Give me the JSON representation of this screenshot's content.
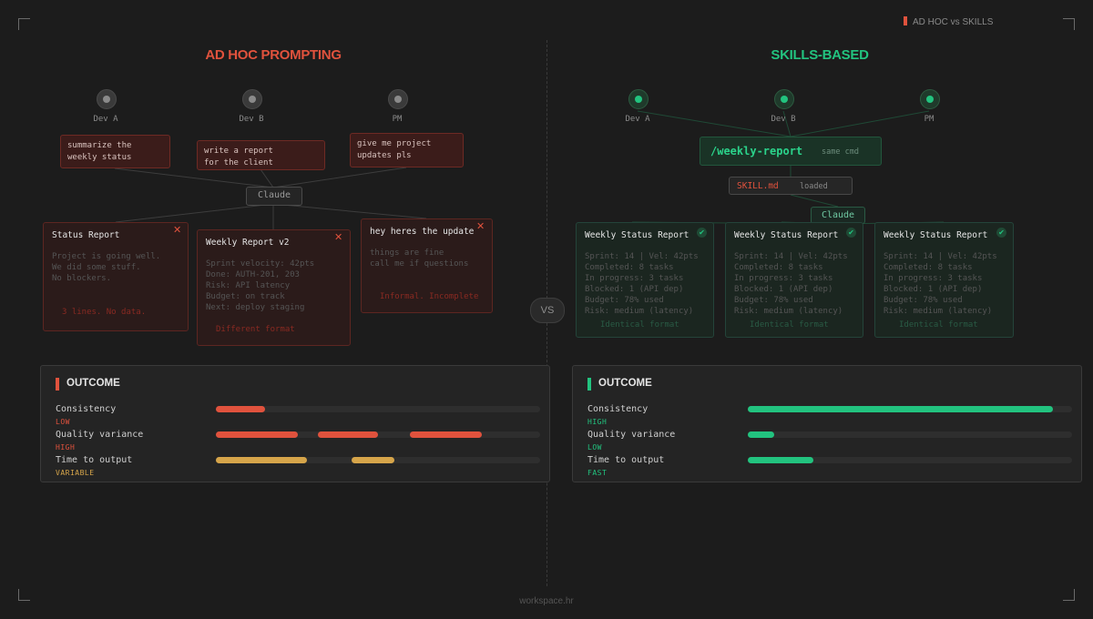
{
  "tag": "AD HOC vs SKILLS",
  "left": {
    "heading": "AD HOC PROMPTING",
    "users": [
      "Dev A",
      "Dev B",
      "PM"
    ],
    "prompts": [
      "summarize the\nweekly status",
      "write a report\nfor the client",
      "give me project\nupdates pls"
    ],
    "model": "Claude",
    "cards": [
      {
        "title": "Status Report",
        "body": "Project is going well.\nWe did some stuff.\nNo blockers.",
        "foot": "3 lines. No data."
      },
      {
        "title": "Weekly Report v2",
        "body": "Sprint velocity: 42pts\nDone: AUTH-201, 203\nRisk: API latency\nBudget: on track\nNext: deploy staging",
        "foot": "Different format"
      },
      {
        "title": "hey heres the update",
        "body": "things are fine\ncall me if questions",
        "foot": "Informal. Incomplete"
      }
    ],
    "outcome": {
      "title": "OUTCOME",
      "metrics": [
        {
          "label": "Consistency",
          "status": "LOW",
          "status_color": "#e0523d"
        },
        {
          "label": "Quality variance",
          "status": "HIGH",
          "status_color": "#e0523d"
        },
        {
          "label": "Time to output",
          "status": "VARIABLE",
          "status_color": "#d6a54a"
        }
      ]
    }
  },
  "right": {
    "heading": "SKILLS-BASED",
    "users": [
      "Dev A",
      "Dev B",
      "PM"
    ],
    "command": "/weekly-report",
    "command_note": "same cmd",
    "skill_file": "SKILL.md",
    "skill_status": "loaded",
    "model": "Claude",
    "cards": [
      {
        "title": "Weekly Status Report",
        "body": "Sprint: 14 | Vel: 42pts\nCompleted: 8 tasks\nIn progress: 3 tasks\nBlocked: 1 (API dep)\nBudget: 78% used\nRisk: medium (latency)",
        "foot": "Identical format"
      },
      {
        "title": "Weekly Status Report",
        "body": "Sprint: 14 | Vel: 42pts\nCompleted: 8 tasks\nIn progress: 3 tasks\nBlocked: 1 (API dep)\nBudget: 78% used\nRisk: medium (latency)",
        "foot": "Identical format"
      },
      {
        "title": "Weekly Status Report",
        "body": "Sprint: 14 | Vel: 42pts\nCompleted: 8 tasks\nIn progress: 3 tasks\nBlocked: 1 (API dep)\nBudget: 78% used\nRisk: medium (latency)",
        "foot": "Identical format"
      }
    ],
    "outcome": {
      "title": "OUTCOME",
      "metrics": [
        {
          "label": "Consistency",
          "status": "HIGH",
          "status_color": "#22c37f"
        },
        {
          "label": "Quality variance",
          "status": "LOW",
          "status_color": "#22c37f"
        },
        {
          "label": "Time to output",
          "status": "FAST",
          "status_color": "#22c37f"
        }
      ]
    }
  },
  "vs": "VS",
  "footer": "workspace.hr",
  "colors": {
    "red": "#e0523d",
    "green": "#22c37f",
    "amber": "#d6a54a"
  }
}
